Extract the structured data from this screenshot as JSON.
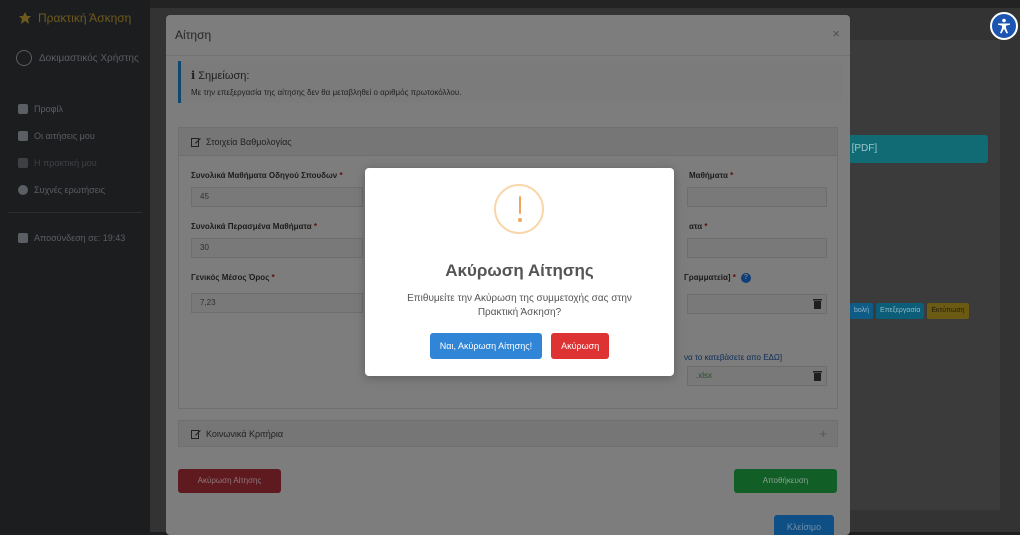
{
  "app": {
    "brand": "Πρακτική Άσκηση",
    "user_name": "Δοκιμαστικός Χρήστης",
    "menu": [
      {
        "label": "Προφίλ",
        "icon": "user-icon"
      },
      {
        "label": "Οι αιτήσεις μου",
        "icon": "edit-icon"
      },
      {
        "label": "Η πρακτική μου",
        "icon": "document-icon"
      },
      {
        "label": "Συχνές ερωτήσεις",
        "icon": "question-icon"
      }
    ],
    "logout_label": "Αποσύνδεση σε: 19:43",
    "background_button": "ς [PDF]",
    "row_buttons": [
      "bολή",
      "Επεξεργασία",
      "Εκτύπωση"
    ]
  },
  "modal": {
    "title": "Αίτηση",
    "close_glyph": "×",
    "note_title": "Σημείωση:",
    "note_text": "Με την επεξεργασία της αίτησης δεν θα μεταβληθεί ο αριθμός πρωτοκόλλου.",
    "grades_panel_title": "Στοιχεία Βαθμολογίας",
    "fields": {
      "total_courses_label": "Συνολικά Μαθήματα Οδηγού Σπουδων",
      "total_courses_value": "45",
      "passed_courses_label": "Συνολικά Περασμένα Μαθήματα",
      "passed_courses_value": "30",
      "gpa_label": "Γενικός Μέσος Όρος",
      "gpa_value": "7,23",
      "right_label_1": "Μαθήματα",
      "right_label_2": "ατα",
      "right_label_3": "Γραμματεία]",
      "right_link": "να το κατεβάσετε απο ΕΔΩ]",
      "right_file": ".xlsx"
    },
    "social_panel_title": "Κοινωνικά Κριτήρια",
    "plus_glyph": "+",
    "cancel_application_button": "Ακύρωση Αίτησης",
    "save_button": "Αποθήκευση",
    "close_button": "Κλείσιμο"
  },
  "alert": {
    "title": "Ακύρωση Αίτησης",
    "text": "Επιθυμείτε την Ακύρωση της συμμετοχής σας στην Πρακτική Άσκηση?",
    "confirm_label": "Ναι, Ακύρωση Αίτησης!",
    "cancel_label": "Ακύρωση",
    "icon": "warning-icon"
  },
  "colors": {
    "confirm": "#3085d6",
    "cancel": "#dd3333",
    "warning": "#f8bb86"
  }
}
